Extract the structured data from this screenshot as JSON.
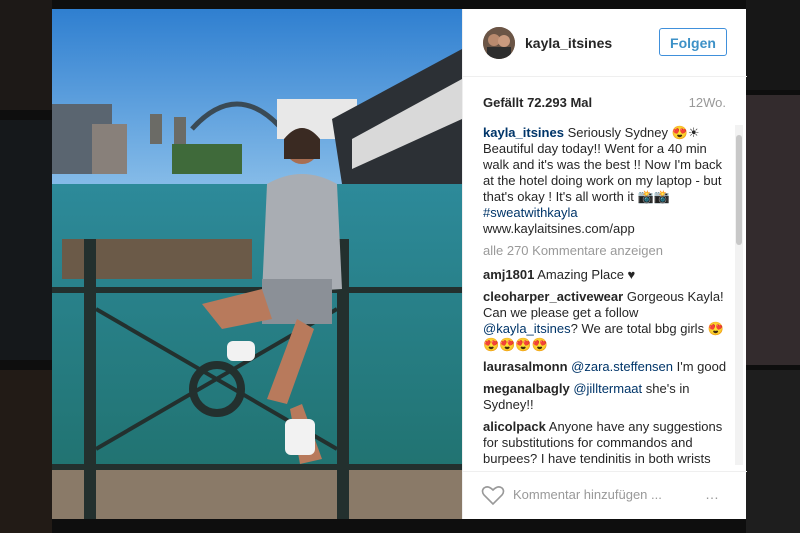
{
  "post": {
    "username": "kayla_itsines",
    "follow_label": "Folgen",
    "likes_text": "Gefällt 72.293 Mal",
    "age": "12Wo."
  },
  "caption": {
    "user": "kayla_itsines",
    "text": "Seriously Sydney 😍☀ Beautiful day today!! Went for a 40 min walk and it's was the best !! Now I'm back at the hotel doing work on my laptop - but that's okay ! It's all worth it 📸📸",
    "hashtag": "#sweatwithkayla",
    "link": "www.kaylaitsines.com/app"
  },
  "show_all_comments": "alle 270 Kommentare anzeigen",
  "comments": [
    {
      "user": "amj1801",
      "text": "Amazing Place ♥"
    },
    {
      "user": "cleoharper_activewear",
      "text": "Gorgeous Kayla! Can we please get a follow",
      "mention": "@kayla_itsines",
      "text2": "? We are total bbg girls 😍😍😍😍😍"
    },
    {
      "user": "laurasalmonn",
      "mention": "@zara.steffensen",
      "text2": " I'm good"
    },
    {
      "user": "meganalbagly",
      "mention": "@jilltermaat",
      "text2": " she's in Sydney!!"
    },
    {
      "user": "alicolpack",
      "text": "Anyone have any suggestions for substitutions for commandos and burpees? I have tendinitis in both wrists and this is especially hard on them"
    }
  ],
  "footer": {
    "comment_placeholder": "Kommentar hinzufügen ...",
    "more_icon": "…"
  }
}
